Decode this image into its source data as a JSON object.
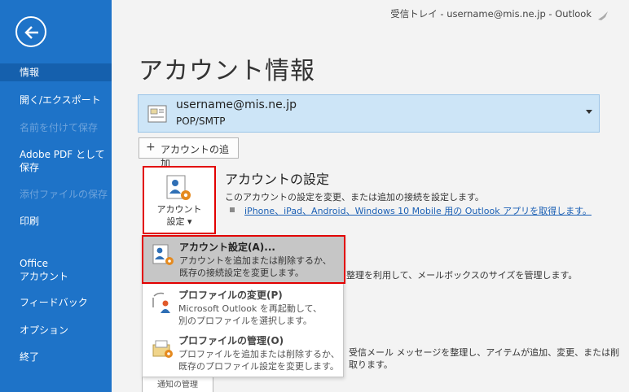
{
  "titlebar": {
    "text": "受信トレイ - username@mis.ne.jp  -  Outlook"
  },
  "sidebar": {
    "items": [
      {
        "label": "情報"
      },
      {
        "label": "開く/エクスポート"
      },
      {
        "label": "名前を付けて保存"
      },
      {
        "label": "Adobe PDF として\n保存"
      },
      {
        "label": "添付ファイルの保存"
      },
      {
        "label": "印刷"
      },
      {
        "label": "Office\nアカウント"
      },
      {
        "label": "フィードバック"
      },
      {
        "label": "オプション"
      },
      {
        "label": "終了"
      }
    ]
  },
  "page": {
    "title": "アカウント情報"
  },
  "account": {
    "email": "username@mis.ne.jp",
    "type": "POP/SMTP",
    "add_label": "アカウントの追加"
  },
  "settings": {
    "button_label_1": "アカウント",
    "button_label_2": "設定 ▾",
    "title": "アカウントの設定",
    "description": "このアカウントの設定を変更、または追加の接続を設定します。",
    "link": "iPhone、iPad、Android、Windows 10 Mobile 用の Outlook アプリを取得します。"
  },
  "background": {
    "text1": "整理を利用して、メールボックスのサイズを管理します。",
    "text2": "受信メール メッセージを整理し、アイテムが追加、変更、または削",
    "text3": "取ります。",
    "hidden_button": "通知の管理"
  },
  "menu": {
    "items": [
      {
        "title": "アカウント設定(A)...",
        "desc1": "アカウントを追加または削除するか、",
        "desc2": "既存の接続設定を変更します。"
      },
      {
        "title": "プロファイルの変更(P)",
        "desc1": "Microsoft Outlook を再起動して、",
        "desc2": "別のプロファイルを選択します。"
      },
      {
        "title": "プロファイルの管理(O)",
        "desc1": "プロファイルを追加または削除するか、",
        "desc2": "既存のプロファイル設定を変更します。"
      }
    ]
  },
  "colors": {
    "sidebar": "#1e73c8",
    "highlight_border": "#e20000",
    "link": "#1a5fb4"
  }
}
